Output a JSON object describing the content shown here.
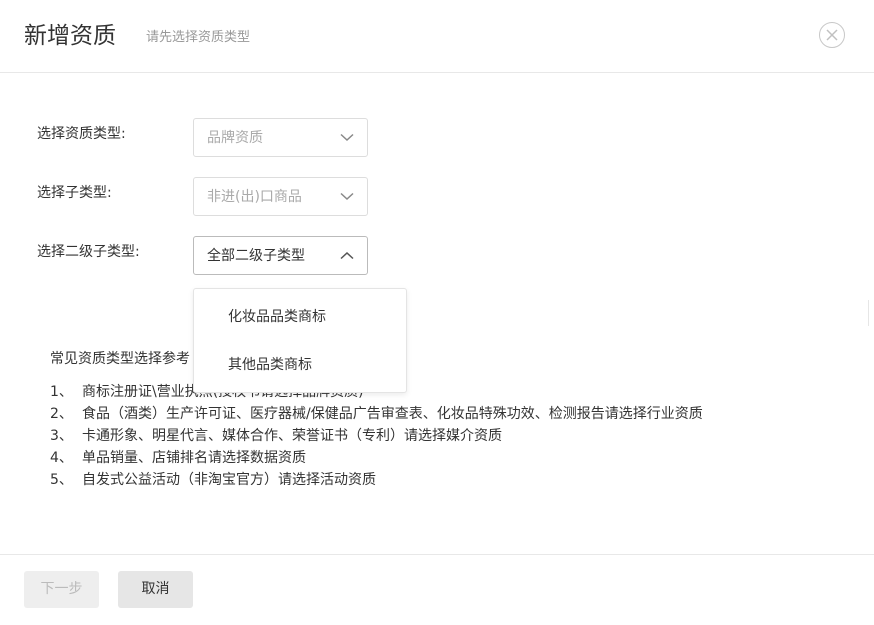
{
  "dialog": {
    "title": "新增资质",
    "subtitle": "请先选择资质类型"
  },
  "form": {
    "type_label": "选择资质类型:",
    "type_value": "品牌资质",
    "subtype_label": "选择子类型:",
    "subtype_value": "非进(出)口商品",
    "level2_label": "选择二级子类型:",
    "level2_value": "全部二级子类型"
  },
  "dropdown": {
    "options": [
      "化妆品品类商标",
      "其他品类商标"
    ]
  },
  "reference": {
    "title": "常见资质类型选择参考",
    "items": [
      {
        "num": "1、",
        "text": "商标注册证\\营业执照(授权书请选择品牌资质)"
      },
      {
        "num": "2、",
        "text": "食品（酒类）生产许可证、医疗器械/保健品广告审查表、化妆品特殊功效、检测报告请选择行业资质"
      },
      {
        "num": "3、",
        "text": "卡通形象、明星代言、媒体合作、荣誉证书（专利）请选择媒介资质"
      },
      {
        "num": "4、",
        "text": "单品销量、店铺排名请选择数据资质"
      },
      {
        "num": "5、",
        "text": "自发式公益活动（非淘宝官方）请选择活动资质"
      }
    ]
  },
  "footer": {
    "next_label": "下一步",
    "cancel_label": "取消"
  },
  "icons": {
    "close": "close-icon",
    "chevron_down": "chevron-down-icon",
    "chevron_up": "chevron-up-icon"
  }
}
